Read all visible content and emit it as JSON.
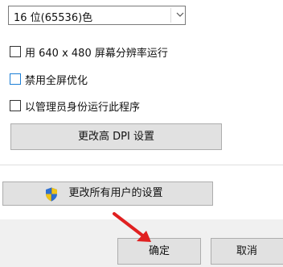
{
  "color_select": {
    "value": "16 位(65536)色",
    "chevron_icon": "chevron-down-icon"
  },
  "options": [
    {
      "label": "用 640 x 480 屏幕分辨率运行",
      "checked": false
    },
    {
      "label": "禁用全屏优化",
      "checked": false
    },
    {
      "label": "以管理员身份运行此程序",
      "checked": false
    }
  ],
  "dpi_button": {
    "label": "更改高 DPI 设置"
  },
  "all_users_button": {
    "label": "更改所有用户的设置",
    "icon": "uac-shield-icon"
  },
  "footer": {
    "ok_label": "确定",
    "cancel_label": "取消"
  },
  "annotation": {
    "icon": "red-arrow-icon",
    "color": "#e02020"
  },
  "colors": {
    "button_face": "#e1e1e1",
    "footer_bg": "#f0f0f0",
    "focus_blue": "#1c7fd6"
  }
}
